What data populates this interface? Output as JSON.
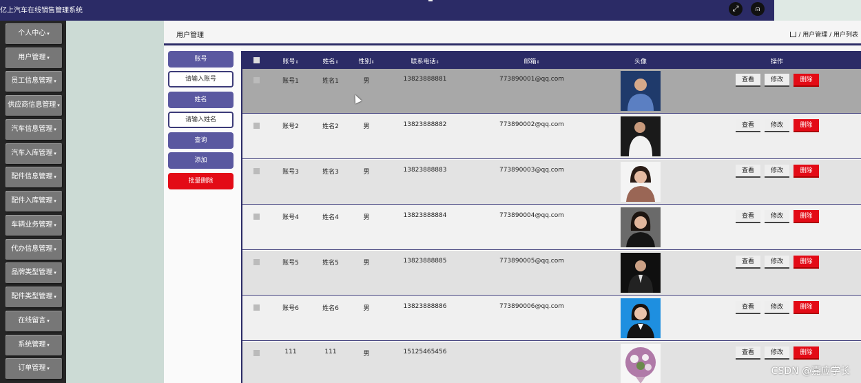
{
  "app_title": "亿上汽车在线销售管理系统",
  "header_icons": [
    "fullscreen-icon",
    "user-icon"
  ],
  "sidebar": {
    "items": [
      {
        "label": "个人中心"
      },
      {
        "label": "用户管理"
      },
      {
        "label": "员工信息管理"
      },
      {
        "label": "供应商信息管理"
      },
      {
        "label": "汽车信息管理"
      },
      {
        "label": "汽车入库管理"
      },
      {
        "label": "配件信息管理"
      },
      {
        "label": "配件入库管理"
      },
      {
        "label": "车辆业务管理"
      },
      {
        "label": "代办信息管理"
      },
      {
        "label": "品牌类型管理"
      },
      {
        "label": "配件类型管理"
      },
      {
        "label": "在线留言"
      },
      {
        "label": "系统管理"
      },
      {
        "label": "订单管理"
      }
    ]
  },
  "page": {
    "title": "用户管理",
    "breadcrumb": "/ 用户管理 / 用户列表"
  },
  "search": {
    "account_label": "账号",
    "account_placeholder": "请输入账号",
    "name_label": "姓名",
    "name_placeholder": "请输入姓名",
    "query_button": "查询",
    "add_button": "添加",
    "batch_delete_button": "批量删除"
  },
  "table": {
    "columns": [
      "账号",
      "姓名",
      "性别",
      "联系电话",
      "邮箱",
      "头像",
      "操作"
    ],
    "sort_icon": "⇕",
    "actions": {
      "view": "查看",
      "edit": "修改",
      "delete": "删除"
    },
    "rows": [
      {
        "account": "账号1",
        "name": "姓名1",
        "gender": "男",
        "phone": "13823888881",
        "email": "773890001@qq.com"
      },
      {
        "account": "账号2",
        "name": "姓名2",
        "gender": "男",
        "phone": "13823888882",
        "email": "773890002@qq.com"
      },
      {
        "account": "账号3",
        "name": "姓名3",
        "gender": "男",
        "phone": "13823888883",
        "email": "773890003@qq.com"
      },
      {
        "account": "账号4",
        "name": "姓名4",
        "gender": "男",
        "phone": "13823888884",
        "email": "773890004@qq.com"
      },
      {
        "account": "账号5",
        "name": "姓名5",
        "gender": "男",
        "phone": "13823888885",
        "email": "773890005@qq.com"
      },
      {
        "account": "账号6",
        "name": "姓名6",
        "gender": "男",
        "phone": "13823888886",
        "email": "773890006@qq.com"
      },
      {
        "account": "111",
        "name": "111",
        "gender": "男",
        "phone": "15125465456",
        "email": ""
      }
    ]
  },
  "watermark": "CSDN @嘉应学长",
  "colors": {
    "header": "#2b2b66",
    "accent": "#5a58a0",
    "danger": "#e30b16"
  }
}
